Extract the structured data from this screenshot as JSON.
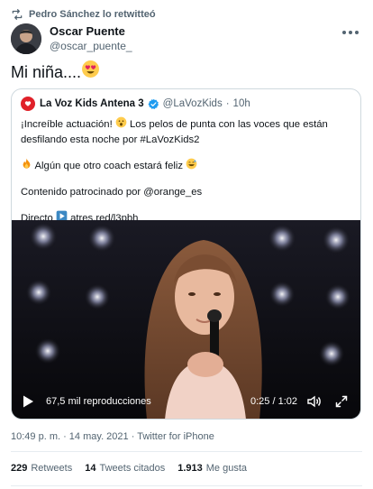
{
  "retweet": {
    "text": "Pedro Sánchez lo retwitteó"
  },
  "author": {
    "name": "Oscar Puente",
    "handle": "@oscar_puente_"
  },
  "tweet": {
    "text": "Mi niña...."
  },
  "quote": {
    "name": "La Voz Kids Antena 3",
    "handle": "@LaVozKids",
    "separator": "·",
    "time": "10h",
    "line1": "¡Increíble actuación!",
    "line1b": " Los pelos de punta con las voces que están desfilando esta noche por #LaVozKids2",
    "line2": " Algún que otro coach estará feliz",
    "line3": "Contenido patrocinado por @orange_es",
    "line4_label": "Directo",
    "line4_link": " atres.red/l3pbh"
  },
  "video": {
    "views": "67,5 mil reproducciones",
    "time": "0:25 / 1:02"
  },
  "meta": {
    "text": "10:49 p. m. · 14 may. 2021 · Twitter for iPhone"
  },
  "stats": {
    "retweets_count": "229",
    "retweets_label": "Retweets",
    "quotes_count": "14",
    "quotes_label": "Tweets citados",
    "likes_count": "1.913",
    "likes_label": "Me gusta"
  },
  "icons": {
    "retweet": "retweet-icon",
    "more": "more-icon",
    "heart_eyes": "heart-eyes-emoji",
    "verified": "verified-badge-icon",
    "astonished": "astonished-emoji",
    "fire": "fire-emoji",
    "grin_sweat": "grin-sweat-emoji",
    "play_square": "play-square-emoji",
    "play": "play-icon",
    "volume": "volume-icon",
    "fullscreen": "fullscreen-icon"
  },
  "colors": {
    "accent": "#1d9bf0",
    "muted": "#536471",
    "brand_red": "#e02129"
  }
}
